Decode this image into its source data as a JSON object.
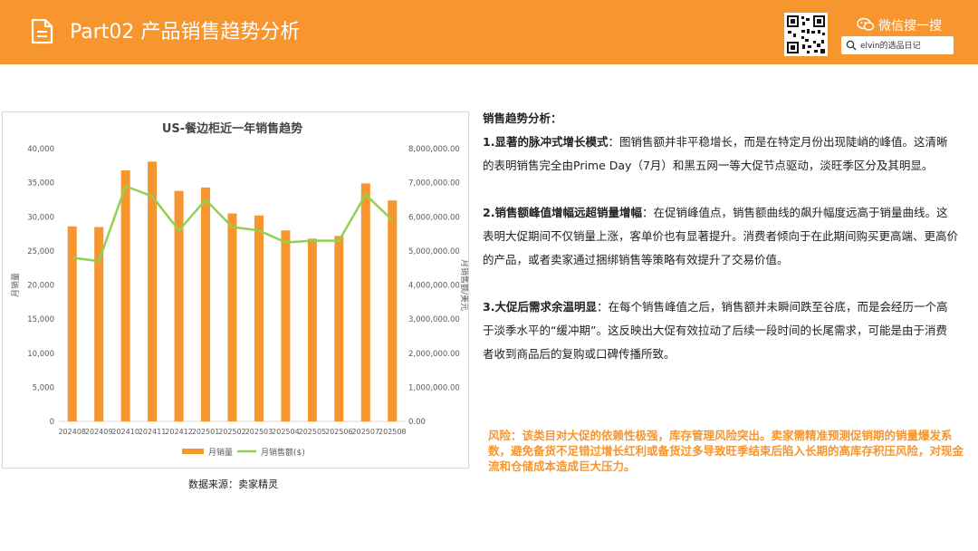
{
  "header": {
    "title": "Part02 产品销售趋势分析",
    "wechat_label": "微信搜一搜",
    "search_text": "elvin的选品日记",
    "bg_color": "#f7952e"
  },
  "chart_data": {
    "type": "bar",
    "title": "US-餐边柜近一年销售趋势",
    "categories": [
      "202408",
      "202409",
      "202410",
      "202411",
      "202412",
      "202501",
      "202502",
      "202503",
      "202504",
      "202505",
      "202506",
      "202507",
      "202508"
    ],
    "series": [
      {
        "name": "月销量",
        "type": "bar",
        "axis": "left",
        "color": "#f7952e",
        "values": [
          28600,
          28500,
          36800,
          38100,
          33800,
          34300,
          30500,
          30200,
          28000,
          26800,
          27200,
          34900,
          32400
        ]
      },
      {
        "name": "月销售额($)",
        "type": "line",
        "axis": "right",
        "color": "#92d050",
        "values": [
          4800000,
          4700000,
          6900000,
          6600000,
          5600000,
          6500000,
          5700000,
          5600000,
          5250000,
          5300000,
          5300000,
          6650000,
          5900000
        ]
      }
    ],
    "ylabel": "月销量",
    "y2label": "月销售额/美元",
    "ylim": [
      0,
      40000
    ],
    "y2lim": [
      0,
      8000000
    ],
    "yticks": [
      "0",
      "5,000",
      "10,000",
      "15,000",
      "20,000",
      "25,000",
      "30,000",
      "35,000",
      "40,000"
    ],
    "y2ticks": [
      "0.00",
      "1,000,000.00",
      "2,000,000.00",
      "3,000,000.00",
      "4,000,000.00",
      "5,000,000.00",
      "6,000,000.00",
      "7,000,000.00",
      "8,000,000.00"
    ],
    "legend_position": "bottom",
    "grid": false
  },
  "source": "数据来源：卖家精灵",
  "analysis": {
    "heading": "销售趋势分析：",
    "p1_title": "1.显著的脉冲式增长模式",
    "p1_text": "：图销售额并非平稳增长，而是在特定月份出现陡峭的峰值。这清晰的表明销售完全由Prime Day（7月）和黑五网一等大促节点驱动，淡旺季区分及其明显。",
    "p2_title": "2.销售额峰值增幅远超销量增幅",
    "p2_text": "：在促销峰值点，销售额曲线的飙升幅度远高于销量曲线。这表明大促期间不仅销量上涨，客单价也有显著提升。消费者倾向于在此期间购买更高端、更高价的产品，或者卖家通过捆绑销售等策略有效提升了交易价值。",
    "p3_title": "3.大促后需求余温明显",
    "p3_text": "：在每个销售峰值之后，销售额并未瞬间跌至谷底，而是会经历一个高于淡季水平的“缓冲期”。这反映出大促有效拉动了后续一段时间的长尾需求，可能是由于消费者收到商品后的复购或口碑传播所致。"
  },
  "risk": "风险：该类目对大促的依赖性极强，库存管理风险突出。卖家需精准预测促销期的销量爆发系数，避免备货不足错过增长红利或备货过多导致旺季结束后陷入长期的高库存积压风险，对现金流和仓储成本造成巨大压力。",
  "colors": {
    "accent": "#f7952e",
    "line": "#92d050"
  }
}
